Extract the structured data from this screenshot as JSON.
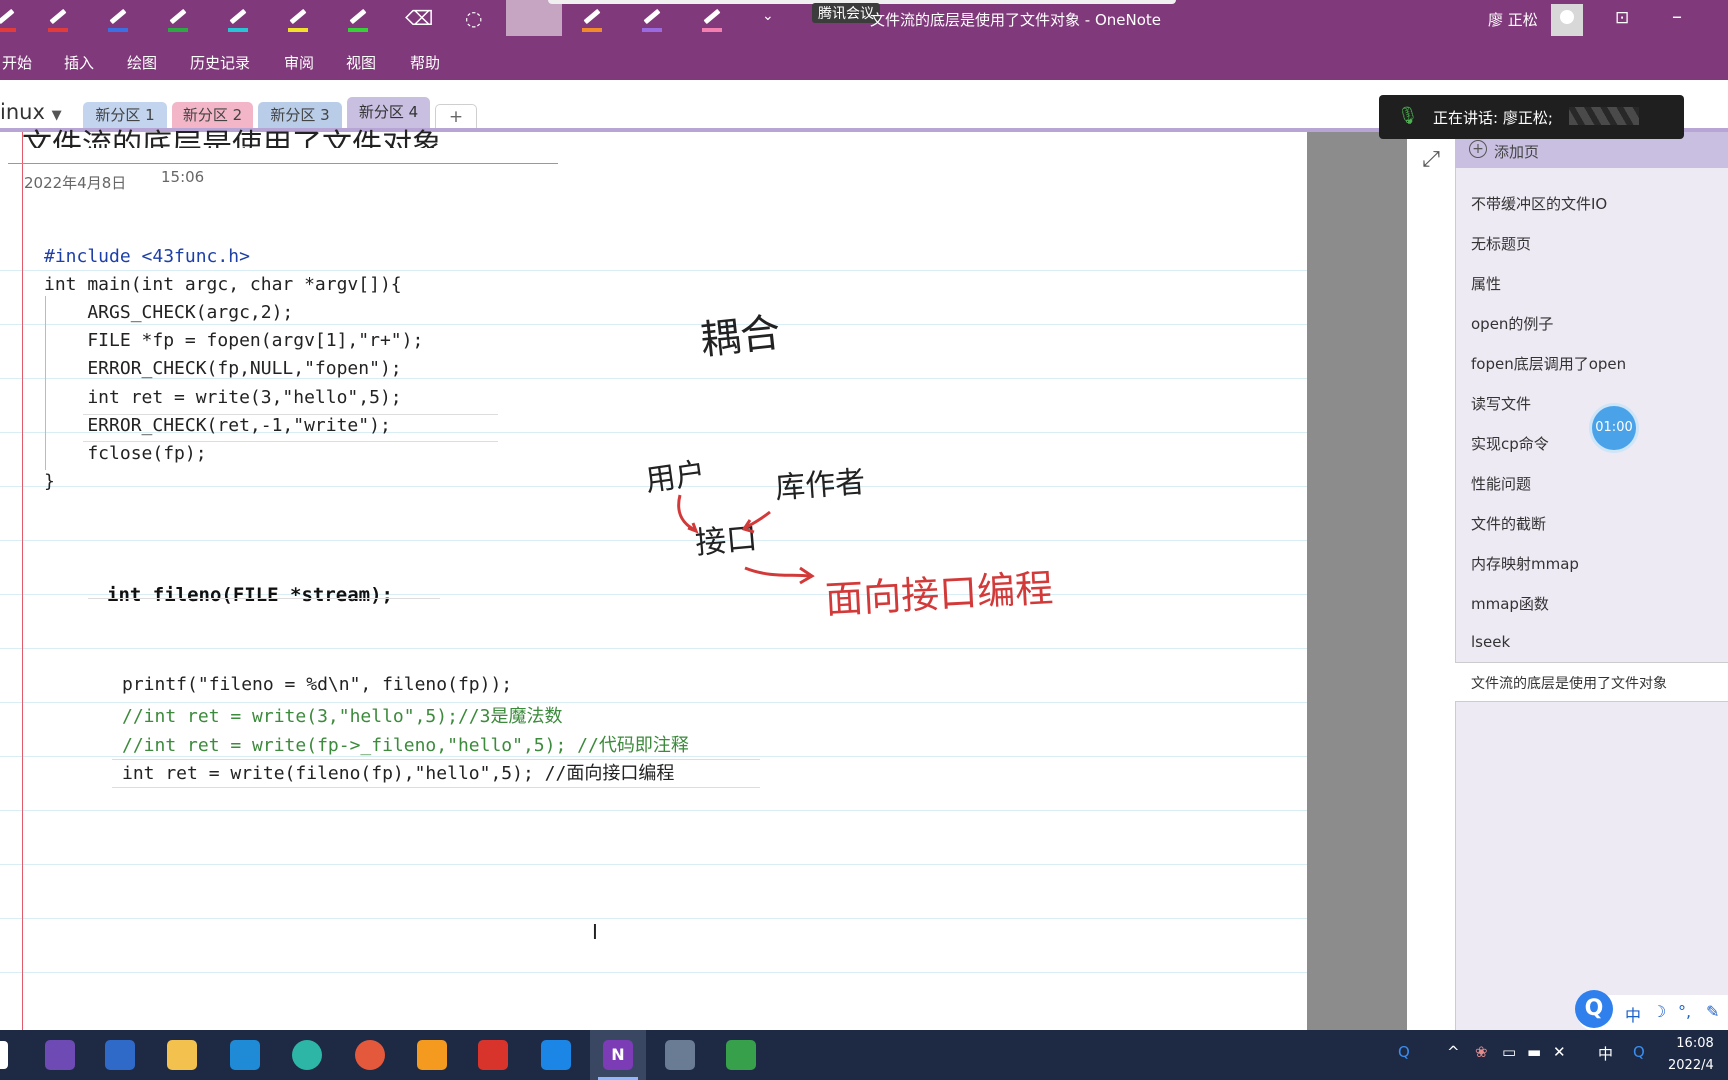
{
  "window": {
    "title": "文件流的底层是使用了文件对象 - OneNote",
    "meeting_label": "腾讯会议",
    "user_name": "廖 正松"
  },
  "menu": [
    "开始",
    "插入",
    "绘图",
    "历史记录",
    "审阅",
    "视图",
    "帮助"
  ],
  "notebook": {
    "name": "inux",
    "sections": [
      {
        "label": "新分区 1",
        "color": "#c2d4ee"
      },
      {
        "label": "新分区 2",
        "color": "#f3b6c9"
      },
      {
        "label": "新分区 3",
        "color": "#b9cde9"
      },
      {
        "label": "新分区 4",
        "color": "#c9bfe0"
      }
    ],
    "add_section": "+"
  },
  "page": {
    "title": "文件流的底层是使用了文件对象",
    "date": "2022年4月8日",
    "time": "15:06",
    "function_prototype": "int fileno(FILE *stream);",
    "ink_notes": [
      "耦合",
      "用户",
      "接口",
      "库作者",
      "面向接口编程"
    ]
  },
  "code_block_1": [
    "#include <43func.h>",
    "int main(int argc, char *argv[]){",
    "    ARGS_CHECK(argc,2);",
    "    FILE *fp = fopen(argv[1],\"r+\");",
    "    ERROR_CHECK(fp,NULL,\"fopen\");",
    "    int ret = write(3,\"hello\",5);",
    "    ERROR_CHECK(ret,-1,\"write\");",
    "    fclose(fp);",
    "}"
  ],
  "code_block_2": [
    "printf(\"fileno = %d\\n\", fileno(fp));",
    "//int ret = write(3,\"hello\",5);//3是魔法数",
    "//int ret = write(fp->_fileno,\"hello\",5); //代码即注释",
    "int ret = write(fileno(fp),\"hello\",5); //面向接口编程"
  ],
  "sidebar": {
    "add_page": "添加页",
    "pages": [
      "不带缓冲区的文件IO",
      "无标题页",
      "属性",
      "open的例子",
      "fopen底层调用了open",
      "读写文件",
      "实现cp命令",
      "性能问题",
      "文件的截断",
      "内存映射mmap",
      "mmap函数",
      "lseek",
      "文件流的底层是使用了文件对象"
    ],
    "selected_index": 12
  },
  "overlay": {
    "speaking_label": "正在讲话: 廖正松;",
    "timer": "01:00"
  },
  "taskbar": {
    "apps": [
      "visual-studio",
      "file-manager",
      "folder",
      "vscode",
      "edge",
      "app-swirl",
      "app-orange",
      "app-red-v",
      "app-blue",
      "onenote",
      "calculator",
      "app-green-red"
    ],
    "active_app": "onenote",
    "time": "16:08",
    "date": "2022/4",
    "ime": "中",
    "ime_bar": [
      "中",
      "☽",
      "°,",
      "✎"
    ]
  },
  "colors": {
    "ribbon": "#80397b",
    "accent_tab": "#b7a5d6",
    "margin_line": "#e25b6a",
    "ink_red": "#d23a3a"
  }
}
